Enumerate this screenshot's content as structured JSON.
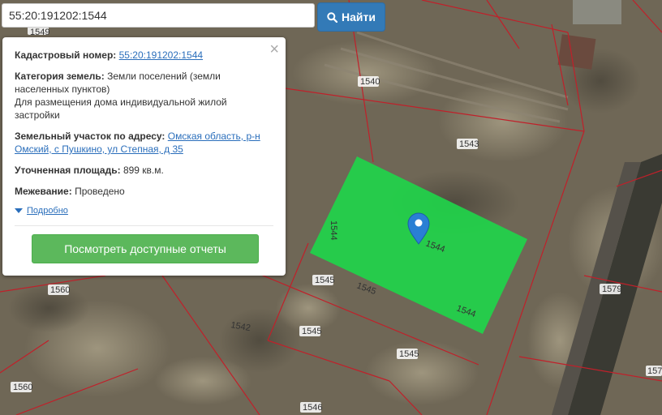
{
  "search": {
    "value": "55:20:191202:1544",
    "button_label": "Найти"
  },
  "popup": {
    "cadastral_label": "Кадастровый номер:",
    "cadastral_value": "55:20:191202:1544",
    "category_label": "Категория земель:",
    "category_value": "Земли поселений (земли населенных пунктов)",
    "purpose": "Для размещения дома индивидуальной жилой застройки",
    "address_label": "Земельный участок по адресу:",
    "address_value": "Омская область, р-н Омский, с Пушкино, ул Степная, д 35",
    "area_label": "Уточненная площадь:",
    "area_value": "899 кв.м.",
    "survey_label": "Межевание:",
    "survey_value": "Проведено",
    "details_link": "Подробно",
    "reports_button": "Посмотреть доступные отчеты"
  },
  "map": {
    "parcel_labels": {
      "p1540": "1540",
      "p1543": "1543",
      "p1544": "1544",
      "p1544b": "1544",
      "p1544c": "1544",
      "p1545a": "1545",
      "p1545b": "1545",
      "p1545c": "1545",
      "p1545d": "1545",
      "p1542": "1542",
      "p1560a": "1560",
      "p1560b": "1560",
      "p1546": "1546",
      "p1579": "1579",
      "p157": "157",
      "p1549": "1549"
    },
    "selected_parcel_color": "#1fd44a",
    "boundary_color": "#c0202a",
    "marker_color": "#2a7fd4"
  }
}
